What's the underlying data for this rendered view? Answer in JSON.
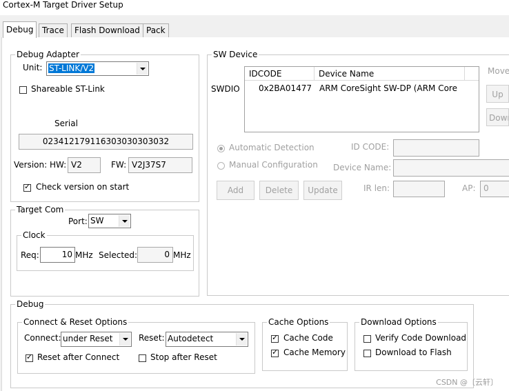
{
  "window": {
    "title": "Cortex-M Target Driver Setup"
  },
  "tabs": [
    {
      "label": "Debug",
      "active": true
    },
    {
      "label": "Trace",
      "active": false
    },
    {
      "label": "Flash Download",
      "active": false
    },
    {
      "label": "Pack",
      "active": false
    }
  ],
  "debug_adapter": {
    "title": "Debug Adapter",
    "unit_label": "Unit:",
    "unit_value": "ST-LINK/V2",
    "shareable_label": "Shareable ST-Link",
    "shareable_checked": false,
    "serial_label": "Serial",
    "serial_value": "023412179116303030303032",
    "version_label": "Version: HW:",
    "hw_value": "V2",
    "fw_label": "FW:",
    "fw_value": "V2J37S7",
    "check_version_label": "Check version on start",
    "check_version_checked": true
  },
  "target_com": {
    "title": "Target Com",
    "port_label": "Port:",
    "port_value": "SW",
    "clock_title": "Clock",
    "req_label": "Req:",
    "req_value": "10",
    "req_unit": "MHz",
    "selected_label": "Selected:",
    "selected_value": "0",
    "selected_unit": "MHz"
  },
  "sw_device": {
    "title": "SW Device",
    "swdio_label": "SWDIO",
    "columns": [
      "IDCODE",
      "Device Name"
    ],
    "rows": [
      {
        "idcode": "0x2BA01477",
        "device_name": "ARM CoreSight SW-DP (ARM Core"
      }
    ],
    "move_label": "Move",
    "up_label": "Up",
    "down_label": "Down",
    "automatic_label": "Automatic Detection",
    "manual_label": "Manual Configuration",
    "id_code_label": "ID CODE:",
    "device_name_label": "Device Name:",
    "add_label": "Add",
    "delete_label": "Delete",
    "update_label": "Update",
    "ir_len_label": "IR len:",
    "ap_label": "AP:",
    "ap_value": "0"
  },
  "debug": {
    "title": "Debug",
    "connect_reset": {
      "title": "Connect & Reset Options",
      "connect_label": "Connect:",
      "connect_value": "under Reset",
      "reset_label": "Reset:",
      "reset_value": "Autodetect",
      "reset_after_connect_label": "Reset after Connect",
      "reset_after_connect_checked": true,
      "stop_after_reset_label": "Stop after Reset",
      "stop_after_reset_checked": false
    },
    "cache": {
      "title": "Cache Options",
      "cache_code_label": "Cache Code",
      "cache_code_checked": true,
      "cache_memory_label": "Cache Memory",
      "cache_memory_checked": true
    },
    "download": {
      "title": "Download Options",
      "verify_label": "Verify Code Download",
      "verify_checked": false,
      "download_flash_label": "Download to Flash",
      "download_flash_checked": false
    }
  },
  "watermark": "CSDN @〔云轩〕"
}
